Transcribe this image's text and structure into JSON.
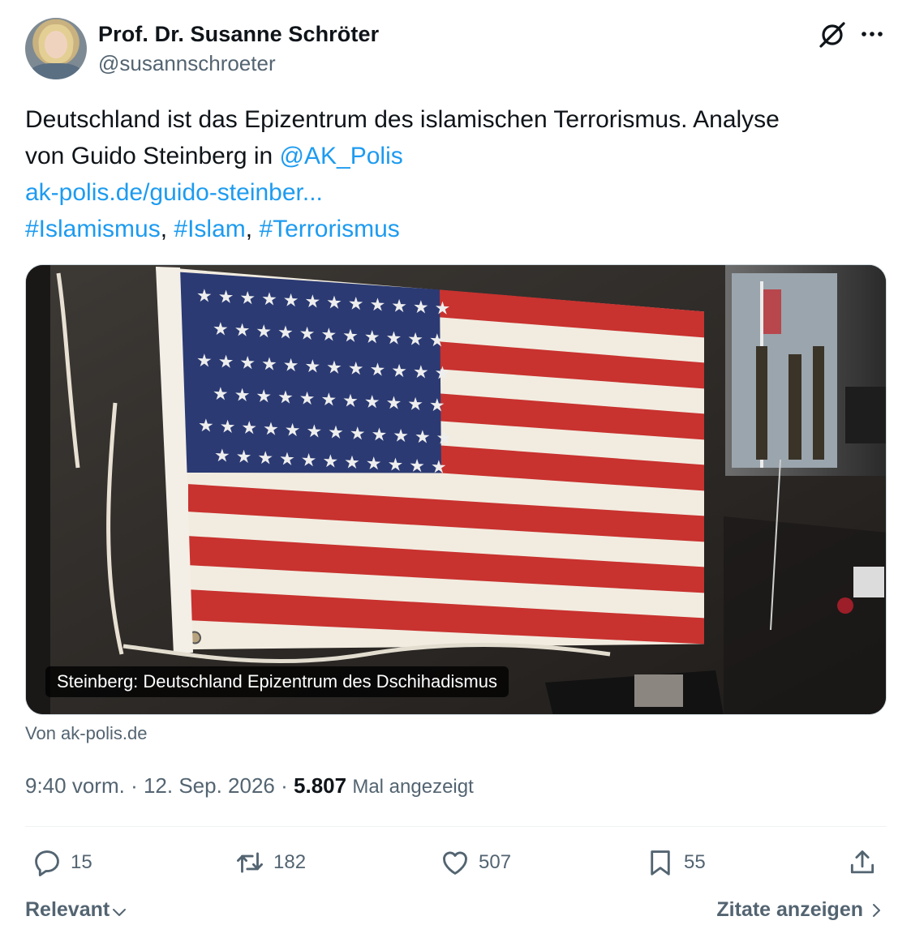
{
  "author": {
    "display_name": "Prof. Dr. Susanne Schröter",
    "handle": "@susannschroeter"
  },
  "tweet": {
    "text_line1": "Deutschland ist das Epizentrum des islamischen Terrorismus. Analyse",
    "text_line2_prefix": "von Guido Steinberg in ",
    "mention": "@AK_Polis",
    "url": "ak-polis.de/guido-steinber...",
    "hashtags": [
      "#Islamismus",
      "#Islam",
      "#Terrorismus"
    ],
    "separator": ","
  },
  "card": {
    "caption": "Steinberg: Deutschland Epizentrum des Dschihadismus",
    "source": "Von ak-polis.de"
  },
  "meta": {
    "time": "9:40 vorm.",
    "dot": "·",
    "date": "12. Sep. 2026",
    "views_count": "5.807",
    "views_label": "Mal angezeigt"
  },
  "actions": {
    "replies": "15",
    "reposts": "182",
    "likes": "507",
    "bookmarks": "55"
  },
  "footer": {
    "sort_label": "Relevant",
    "quotes_label": "Zitate anzeigen"
  },
  "colors": {
    "link": "#1d9bf0",
    "text": "#0f1419",
    "secondary": "#536471",
    "flag_red": "#c8322f",
    "flag_blue": "#2b3a73"
  },
  "icons": [
    "grok-icon",
    "more-icon",
    "reply-icon",
    "retweet-icon",
    "like-icon",
    "bookmark-icon",
    "share-icon",
    "chevron-down-icon",
    "chevron-right-icon"
  ]
}
